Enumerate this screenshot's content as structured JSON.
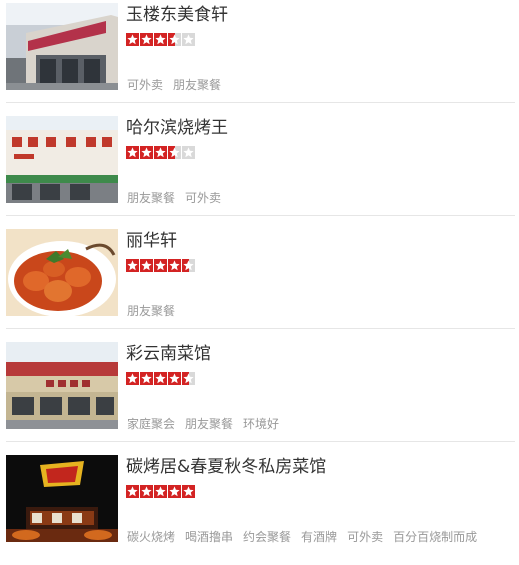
{
  "restaurants": [
    {
      "name": "玉楼东美食轩",
      "rating": 3.5,
      "tags": [
        "可外卖",
        "朋友聚餐"
      ],
      "photo": "restaurant-storefront-photo"
    },
    {
      "name": "哈尔滨烧烤王",
      "rating": 3.5,
      "tags": [
        "朋友聚餐",
        "可外卖"
      ],
      "photo": "restaurant-storefront-photo"
    },
    {
      "name": "丽华轩",
      "rating": 4.5,
      "tags": [
        "朋友聚餐"
      ],
      "photo": "dish-photo"
    },
    {
      "name": "彩云南菜馆",
      "rating": 4.5,
      "tags": [
        "家庭聚会",
        "朋友聚餐",
        "环境好"
      ],
      "photo": "restaurant-storefront-photo"
    },
    {
      "name": "碳烤居&春夏秋冬私房菜馆",
      "rating": 5,
      "tags": [
        "碳火烧烤",
        "喝酒撸串",
        "约会聚餐",
        "有酒牌",
        "可外卖",
        "百分百烧制而成"
      ],
      "photo": "restaurant-logo-photo"
    }
  ],
  "colors": {
    "star_fill": "#d32323",
    "star_empty": "#d9d9d9",
    "name_text": "#333333",
    "tag_text": "#999999",
    "divider": "#e6e6e6"
  }
}
